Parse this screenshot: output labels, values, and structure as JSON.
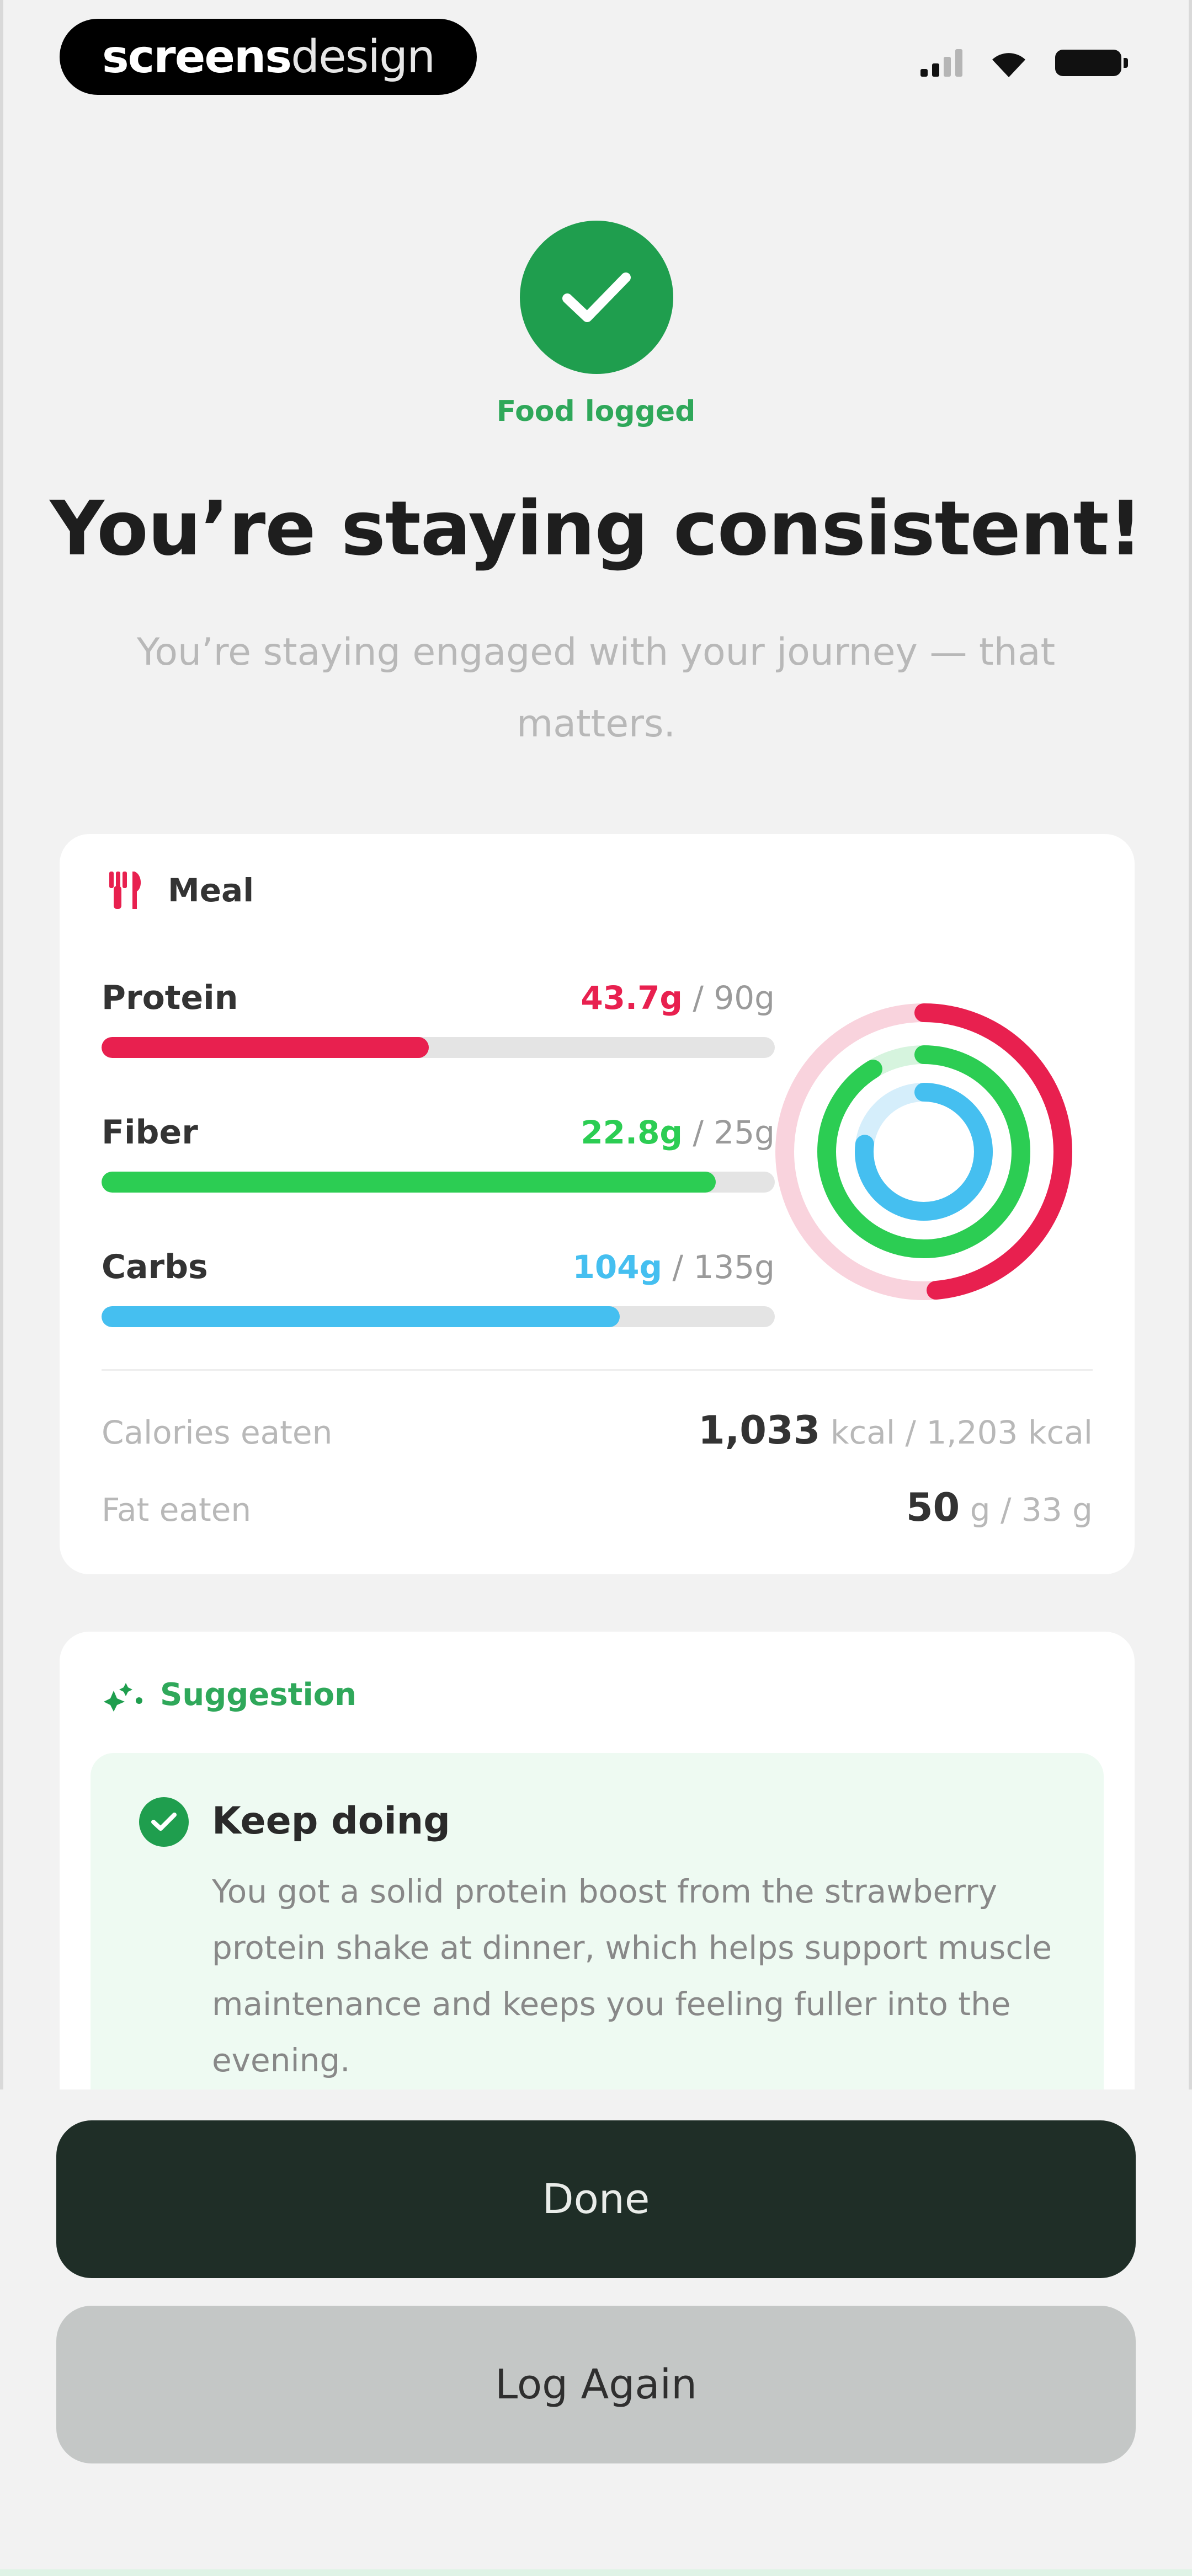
{
  "status_bar": {
    "brand_bold": "screens",
    "brand_light": "design"
  },
  "header": {
    "success_label": "Food logged",
    "title": "You’re staying consistent!",
    "subtitle": "You’re staying engaged with your journey — that matters."
  },
  "meal_card": {
    "label": "Meal",
    "macros": [
      {
        "name": "Protein",
        "current": "43.7g",
        "goal": " / 90g",
        "color": "#e8204f",
        "fraction": 0.486
      },
      {
        "name": "Fiber",
        "current": "22.8g",
        "goal": " / 25g",
        "color": "#2ccd53",
        "fraction": 0.912
      },
      {
        "name": "Carbs",
        "current": "104g",
        "goal": " / 135g",
        "color": "#45bff0",
        "fraction": 0.77
      }
    ],
    "calories": {
      "label": "Calories eaten",
      "value": "1,033",
      "unit": " kcal / 1,203 kcal"
    },
    "fat": {
      "label": "Fat eaten",
      "value": "50",
      "unit": " g / 33 g"
    }
  },
  "suggestion": {
    "label": "Suggestion",
    "title": "Keep doing",
    "body": "You got a solid protein boost from the strawberry protein shake at dinner, which helps support muscle maintenance and keeps you feeling fuller into the evening."
  },
  "buttons": {
    "done": "Done",
    "log_again": "Log Again"
  },
  "colors": {
    "accent_green": "#1f9e4e",
    "dark_button": "#1f2e27",
    "secondary_button": "#c4c7c6"
  }
}
